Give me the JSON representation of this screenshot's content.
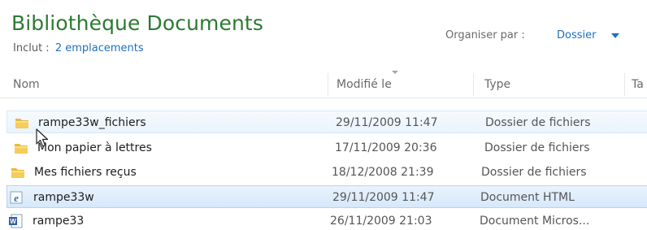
{
  "header": {
    "title": "Bibliothèque Documents",
    "includes_label": "Inclut :",
    "includes_link": "2 emplacements",
    "organize_label": "Organiser par :",
    "organize_value": "Dossier"
  },
  "columns": {
    "name": "Nom",
    "modified": "Modifié le",
    "type": "Type",
    "size": "Ta"
  },
  "rows": [
    {
      "name": "rampe33w_fichiers",
      "date": "29/11/2009 11:47",
      "type": "Dossier de fichiers",
      "icon": "folder-icon",
      "state": "hover"
    },
    {
      "name": "Mon papier à lettres",
      "date": "17/11/2009 20:36",
      "type": "Dossier de fichiers",
      "icon": "folder-icon",
      "state": "normal"
    },
    {
      "name": "Mes fichiers reçus",
      "date": "18/12/2008 21:39",
      "type": "Dossier de fichiers",
      "icon": "folder-icon",
      "state": "normal"
    },
    {
      "name": "rampe33w",
      "date": "29/11/2009 11:47",
      "type": "Document HTML",
      "icon": "ie-html-icon",
      "state": "selected"
    },
    {
      "name": "rampe33",
      "date": "26/11/2009 21:03",
      "type": "Document Micros...",
      "icon": "word-document-icon",
      "state": "normal"
    }
  ],
  "colors": {
    "title": "#2b7a32",
    "link": "#1f6fbf",
    "selected_row": "#d6e8fb",
    "hover_row": "#eaf3fc"
  }
}
